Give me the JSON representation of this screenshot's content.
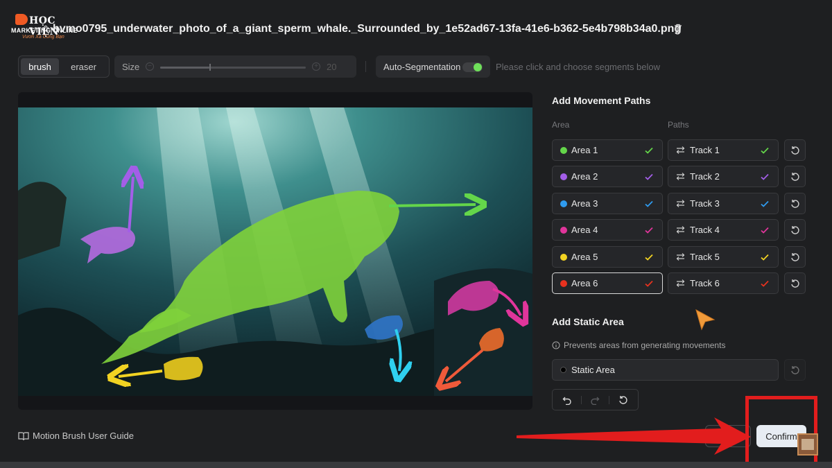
{
  "logo": {
    "brand": "HỌC VIỆN",
    "line1": "MARKETING ONLINE",
    "line2": "Vươn Xa Cùng Bạn"
  },
  "file": {
    "name": "hvmo0795_underwater_photo_of_a_giant_sperm_whale._Surrounded_by_1e52ad67-13fa-41e6-b362-5e4b798b34a0.png"
  },
  "toolbar": {
    "brush_label": "brush",
    "eraser_label": "eraser",
    "size_label": "Size",
    "size_value": "20",
    "size_fraction": 0.34,
    "autoseg_label": "Auto-Segmentation",
    "autoseg_on": true,
    "hint": "Please click and choose segments below"
  },
  "panel": {
    "title": "Add Movement Paths",
    "area_header": "Area",
    "paths_header": "Paths",
    "rows": [
      {
        "area": "Area 1",
        "track": "Track 1",
        "color": "#64d64a"
      },
      {
        "area": "Area 2",
        "track": "Track 2",
        "color": "#a35ee8"
      },
      {
        "area": "Area 3",
        "track": "Track 3",
        "color": "#2f9bef"
      },
      {
        "area": "Area 4",
        "track": "Track 4",
        "color": "#e0359b"
      },
      {
        "area": "Area 5",
        "track": "Track 5",
        "color": "#f2d322"
      },
      {
        "area": "Area 6",
        "track": "Track 6",
        "color": "#e8321f"
      }
    ],
    "selected_index": 5,
    "static_title": "Add Static Area",
    "static_info": "Prevents areas from generating movements",
    "static_label": "Static Area"
  },
  "footer": {
    "guide_label": "Motion Brush User Guide",
    "cancel_label": "Cancel",
    "confirm_label": "Confirm"
  },
  "colors": {
    "accent_green": "#6fe05a",
    "highlight_red": "#e21d1d",
    "confirm_bg": "#e7ecf3"
  }
}
